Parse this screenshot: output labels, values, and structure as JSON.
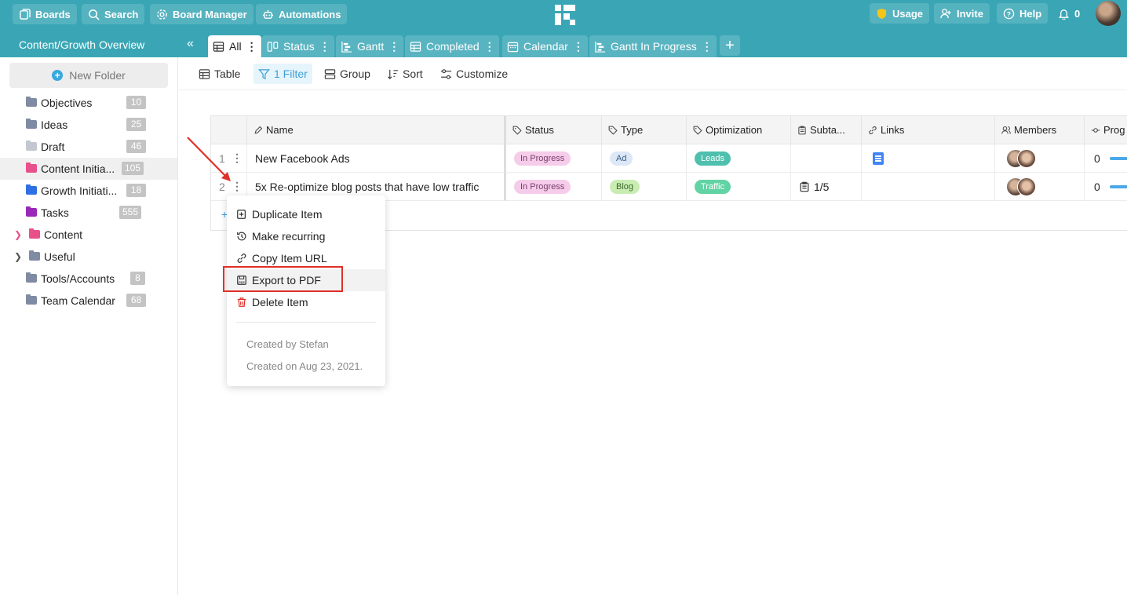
{
  "topbar": {
    "boards_label": "Boards",
    "search_label": "Search",
    "board_manager_label": "Board Manager",
    "automations_label": "Automations",
    "usage_label": "Usage",
    "invite_label": "Invite",
    "help_label": "Help",
    "notifications_count": "0"
  },
  "board": {
    "title": "Content/Growth Overview",
    "tabs": [
      {
        "label": "All",
        "icon": "table-icon"
      },
      {
        "label": "Status",
        "icon": "kanban-icon"
      },
      {
        "label": "Gantt",
        "icon": "gantt-icon"
      },
      {
        "label": "Completed",
        "icon": "table-icon"
      },
      {
        "label": "Calendar",
        "icon": "calendar-icon"
      },
      {
        "label": "Gantt In Progress",
        "icon": "gantt-icon"
      }
    ],
    "add_tab": "+"
  },
  "sidebar": {
    "new_folder_label": "New Folder",
    "folders": [
      {
        "label": "Objectives",
        "count": "10",
        "color": "#7f8aa3"
      },
      {
        "label": "Ideas",
        "count": "25",
        "color": "#7f8aa3"
      },
      {
        "label": "Draft",
        "count": "46",
        "color": "#c3c7d1"
      },
      {
        "label": "Content Initia...",
        "count": "105",
        "color": "#e8508a"
      },
      {
        "label": "Growth Initiati...",
        "count": "18",
        "color": "#2f6fe4"
      },
      {
        "label": "Tasks",
        "count": "555",
        "color": "#9a28b8"
      },
      {
        "label": "Content",
        "count": "",
        "color": "#e8508a"
      },
      {
        "label": "Useful",
        "count": "",
        "color": "#7f8aa3"
      },
      {
        "label": "Tools/Accounts",
        "count": "8",
        "color": "#7f8aa3"
      },
      {
        "label": "Team Calendar",
        "count": "68",
        "color": "#7f8aa3"
      }
    ]
  },
  "toolbar": {
    "table_label": "Table",
    "filter_label": "1 Filter",
    "group_label": "Group",
    "sort_label": "Sort",
    "customize_label": "Customize"
  },
  "grid": {
    "columns": [
      "Name",
      "Status",
      "Type",
      "Optimization",
      "Subta...",
      "Links",
      "Members",
      "Prog"
    ],
    "rows": [
      {
        "num": "1",
        "name": "New Facebook Ads",
        "status": "In Progress",
        "type": "Ad",
        "optimization": "Leads",
        "subtasks": "",
        "progress": "0"
      },
      {
        "num": "2",
        "name": "5x Re-optimize blog posts that have low traffic",
        "status": "In Progress",
        "type": "Blog",
        "optimization": "Traffic",
        "subtasks": "1/5",
        "progress": "0"
      }
    ],
    "add_row": "+"
  },
  "context_menu": {
    "items": [
      {
        "label": "Duplicate Item",
        "icon": "duplicate-icon"
      },
      {
        "label": "Make recurring",
        "icon": "recurring-icon"
      },
      {
        "label": "Copy Item URL",
        "icon": "link-icon"
      },
      {
        "label": "Export to PDF",
        "icon": "pdf-icon"
      },
      {
        "label": "Delete Item",
        "icon": "trash-icon"
      }
    ],
    "created_by": "Created by Stefan",
    "created_on": "Created on Aug 23, 2021."
  },
  "colors": {
    "header_teal": "#3aa6b5",
    "accent_blue": "#3a9fd8",
    "annotation_red": "#e0302a"
  }
}
